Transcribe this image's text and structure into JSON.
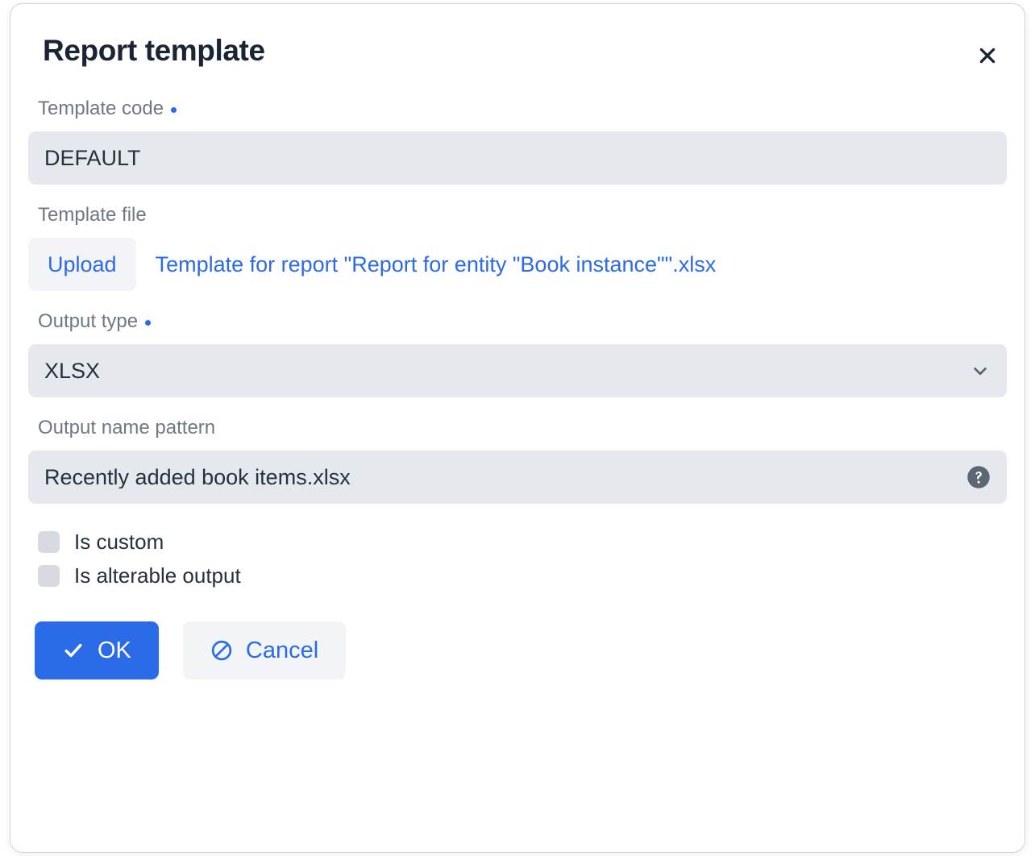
{
  "dialog": {
    "title": "Report template",
    "close_icon": "close-icon"
  },
  "fields": {
    "template_code": {
      "label": "Template code",
      "required": true,
      "value": "DEFAULT"
    },
    "template_file": {
      "label": "Template file",
      "required": false,
      "upload_label": "Upload",
      "file_name": "Template for report \"Report for entity \"Book instance\"\".xlsx"
    },
    "output_type": {
      "label": "Output type",
      "required": true,
      "value": "XLSX",
      "dropdown_icon": "chevron-down-icon"
    },
    "output_name_pattern": {
      "label": "Output name pattern",
      "required": false,
      "value": "Recently added book items.xlsx",
      "help_icon": "help-circle-icon"
    }
  },
  "checkboxes": [
    {
      "label": "Is custom",
      "checked": false
    },
    {
      "label": "Is alterable output",
      "checked": false
    }
  ],
  "footer": {
    "ok_label": "OK",
    "ok_icon": "check-icon",
    "cancel_label": "Cancel",
    "cancel_icon": "ban-icon"
  },
  "colors": {
    "accent_blue": "#2c6be8",
    "input_background": "#e5e9ed",
    "label_gray": "#6e7885",
    "text_dark": "#26303f",
    "checkbox_fill": "#d7dbe1",
    "soft_button": "#f2f4f7"
  }
}
